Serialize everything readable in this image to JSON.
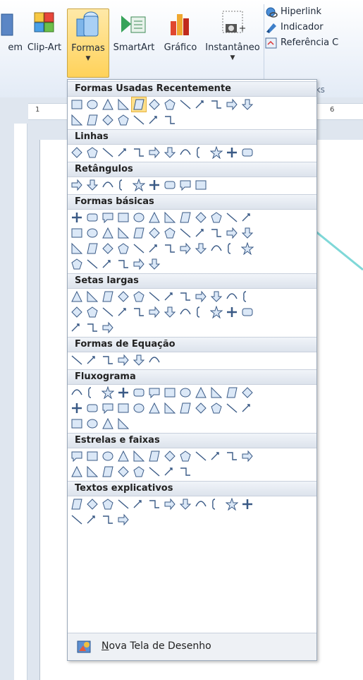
{
  "ribbon": {
    "buttons": [
      {
        "label": "em",
        "name": "imagem-partial"
      },
      {
        "label": "Clip-Art",
        "name": "clip-art"
      },
      {
        "label": "Formas",
        "name": "formas"
      },
      {
        "label": "SmartArt",
        "name": "smartart"
      },
      {
        "label": "Gráfico",
        "name": "grafico"
      },
      {
        "label": "Instantâneo",
        "name": "instantaneo"
      }
    ],
    "links": {
      "hyperlink": "Hiperlink",
      "bookmark": "Indicador",
      "crossref": "Referência C",
      "group_label": "Links"
    },
    "accent_color": "#ffd25a"
  },
  "ruler": {
    "marks": [
      "1",
      "6"
    ]
  },
  "gallery": {
    "sections": [
      {
        "title": "Formas Usadas Recentemente",
        "rows": [
          12,
          7
        ]
      },
      {
        "title": "Linhas",
        "rows": [
          12
        ]
      },
      {
        "title": "Retângulos",
        "rows": [
          9
        ]
      },
      {
        "title": "Formas básicas",
        "rows": [
          12,
          12,
          12,
          6
        ]
      },
      {
        "title": "Setas largas",
        "rows": [
          12,
          12,
          3
        ]
      },
      {
        "title": "Formas de Equação",
        "rows": [
          6
        ]
      },
      {
        "title": "Fluxograma",
        "rows": [
          12,
          12,
          4
        ]
      },
      {
        "title": "Estrelas e faixas",
        "rows": [
          12,
          8
        ]
      },
      {
        "title": "Textos explicativos",
        "rows": [
          12,
          4
        ]
      }
    ],
    "footer": {
      "underlined": "N",
      "label": "ova Tela de Desenho"
    }
  },
  "connector_color": "#7fd8d8"
}
